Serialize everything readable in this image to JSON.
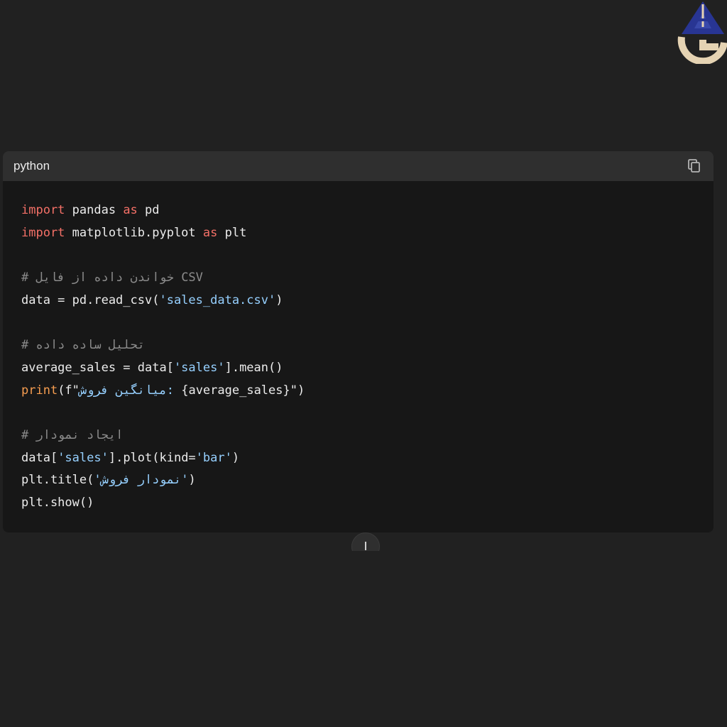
{
  "code_block": {
    "language": "python",
    "lines": [
      {
        "tokens": [
          {
            "t": "import",
            "c": "kw"
          },
          {
            "t": " pandas ",
            "c": ""
          },
          {
            "t": "as",
            "c": "kw"
          },
          {
            "t": " pd",
            "c": ""
          }
        ]
      },
      {
        "tokens": [
          {
            "t": "import",
            "c": "kw"
          },
          {
            "t": " matplotlib.pyplot ",
            "c": ""
          },
          {
            "t": "as",
            "c": "kw"
          },
          {
            "t": " plt",
            "c": ""
          }
        ]
      },
      {
        "tokens": []
      },
      {
        "tokens": [
          {
            "t": "# خواندن داده از فایل CSV",
            "c": "cm"
          }
        ]
      },
      {
        "tokens": [
          {
            "t": "data = pd.read_csv(",
            "c": ""
          },
          {
            "t": "'sales_data.csv'",
            "c": "str"
          },
          {
            "t": ")",
            "c": ""
          }
        ]
      },
      {
        "tokens": []
      },
      {
        "tokens": [
          {
            "t": "# تحلیل ساده داده",
            "c": "cm"
          }
        ]
      },
      {
        "tokens": [
          {
            "t": "average_sales = data[",
            "c": ""
          },
          {
            "t": "'sales'",
            "c": "str"
          },
          {
            "t": "].mean()",
            "c": ""
          }
        ]
      },
      {
        "tokens": [
          {
            "t": "print",
            "c": "fn"
          },
          {
            "t": "(f\"",
            "c": ""
          },
          {
            "t": "میانگین فروش: ",
            "c": "str"
          },
          {
            "t": "{average_sales}\")",
            "c": ""
          }
        ]
      },
      {
        "tokens": []
      },
      {
        "tokens": [
          {
            "t": "# ایجاد نمودار",
            "c": "cm"
          }
        ]
      },
      {
        "tokens": [
          {
            "t": "data[",
            "c": ""
          },
          {
            "t": "'sales'",
            "c": "str"
          },
          {
            "t": "].plot(kind=",
            "c": ""
          },
          {
            "t": "'bar'",
            "c": "str"
          },
          {
            "t": ")",
            "c": ""
          }
        ]
      },
      {
        "tokens": [
          {
            "t": "plt.title(",
            "c": ""
          },
          {
            "t": "'نمودار فروش'",
            "c": "str"
          },
          {
            "t": ")",
            "c": ""
          }
        ]
      },
      {
        "tokens": [
          {
            "t": "plt.show()",
            "c": ""
          }
        ]
      }
    ]
  },
  "icons": {
    "copy": "copy-icon",
    "scroll_down": "arrow-down-icon",
    "logo": "logo-icon"
  },
  "colors": {
    "background": "#212121",
    "code_bg": "#171717",
    "header_bg": "#2f2f2f",
    "keyword": "#f47067",
    "builtin": "#f69d50",
    "string": "#96d0ff",
    "comment": "#8b8b8b",
    "logo_blue": "#283593",
    "logo_beige": "#e5d3b3"
  }
}
